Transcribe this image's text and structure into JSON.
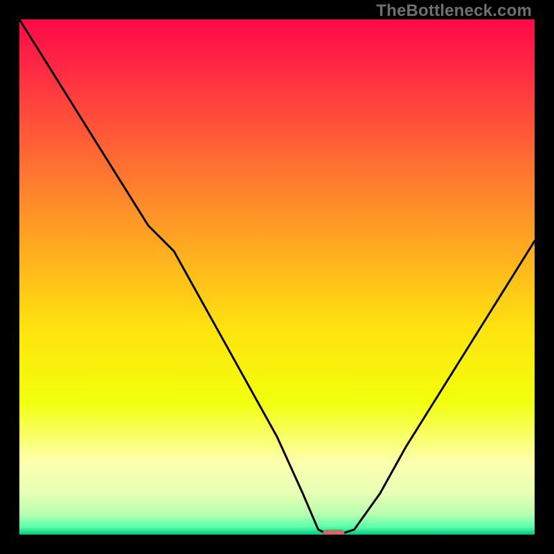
{
  "watermark": "TheBottleneck.com",
  "chart_data": {
    "type": "line",
    "title": "",
    "xlabel": "",
    "ylabel": "",
    "xlim": [
      0,
      100
    ],
    "ylim": [
      0,
      100
    ],
    "series": [
      {
        "name": "bottleneck-curve",
        "x": [
          0,
          5,
          10,
          15,
          20,
          25,
          30,
          35,
          40,
          45,
          50,
          55,
          58,
          60,
          62,
          65,
          70,
          75,
          80,
          85,
          90,
          95,
          100
        ],
        "y": [
          100,
          92,
          84,
          76,
          68,
          60,
          55,
          46,
          37,
          28,
          19,
          8,
          1,
          0,
          0,
          1,
          8,
          17,
          25,
          33,
          41,
          49,
          57
        ]
      }
    ],
    "marker": {
      "name": "sweet-spot-marker",
      "x": 61,
      "y": 0,
      "width_pct": 4.2,
      "height_pct": 1.4,
      "color": "#cf6a66"
    },
    "gradient_stops": [
      {
        "offset": 0.0,
        "color": "#ff0949"
      },
      {
        "offset": 0.1,
        "color": "#ff2b43"
      },
      {
        "offset": 0.28,
        "color": "#ff6f32"
      },
      {
        "offset": 0.45,
        "color": "#ffad20"
      },
      {
        "offset": 0.6,
        "color": "#ffe30f"
      },
      {
        "offset": 0.74,
        "color": "#f2ff0b"
      },
      {
        "offset": 0.86,
        "color": "#fdffae"
      },
      {
        "offset": 0.92,
        "color": "#e6ffb4"
      },
      {
        "offset": 0.96,
        "color": "#b7ffb0"
      },
      {
        "offset": 0.985,
        "color": "#59ffab"
      },
      {
        "offset": 1.0,
        "color": "#00c87c"
      }
    ]
  }
}
